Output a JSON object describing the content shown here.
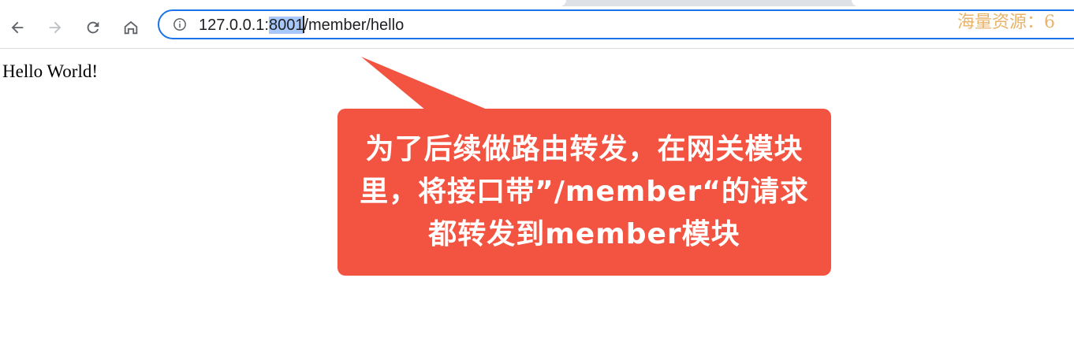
{
  "browser": {
    "url": {
      "prefix": "127.0.0.1:",
      "selected": "8001",
      "suffix": "/member/hello"
    },
    "watermark": "海量资源：6"
  },
  "page": {
    "body_text": "Hello World!"
  },
  "callout": {
    "text": "为了后续做路由转发，在网关模块里，将接口带”/member“的请求都转发到member模块",
    "color": "#f25441"
  },
  "icons": {
    "back": "arrow-left-icon",
    "forward": "arrow-right-icon",
    "reload": "reload-icon",
    "home": "home-icon",
    "info": "info-icon"
  }
}
